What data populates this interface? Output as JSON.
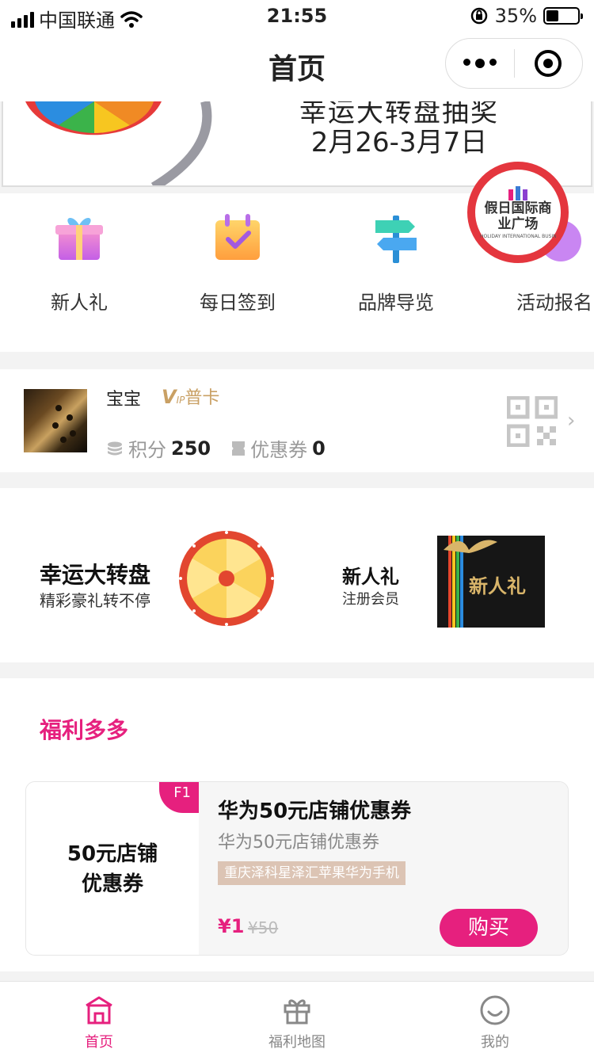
{
  "status_bar": {
    "carrier": "中国联通",
    "time": "21:55",
    "battery": "35%",
    "battery_level": 0.35
  },
  "nav": {
    "title": "首页"
  },
  "banner": {
    "title": "幸运大转盘抽奖",
    "dates": "2月26-3月7日"
  },
  "quick_entries": [
    {
      "label": "新人礼",
      "icon": "gift-icon"
    },
    {
      "label": "每日签到",
      "icon": "calendar-check-icon"
    },
    {
      "label": "品牌导览",
      "icon": "signpost-icon"
    },
    {
      "label": "活动报名",
      "icon": "activity-icon"
    }
  ],
  "logo_badge": {
    "text": "假日国际商业广场",
    "subtext": "HOLIDAY INTERNATIONAL BUSINESS PLAZA"
  },
  "member": {
    "name": "宝宝",
    "vip_mark": "V",
    "vip_level": "普卡",
    "points_label": "积分",
    "points": "250",
    "coupons_label": "优惠券",
    "coupons": "0"
  },
  "promos": {
    "wheel_title": "幸运大转盘",
    "wheel_sub": "精彩豪礼转不停",
    "gift_title": "新人礼",
    "gift_sub": "注册会员",
    "gift_box_text": "新人礼"
  },
  "welfare": {
    "section_title": "福利多多",
    "coupon": {
      "badge": "F1",
      "left_line1": "50元店铺",
      "left_line2": "优惠券",
      "title": "华为50元店铺优惠券",
      "subtitle": "华为50元店铺优惠券",
      "tag": "重庆泽科星泽汇苹果华为手机",
      "price": "¥1",
      "original_price": "¥50",
      "buy_label": "购买"
    }
  },
  "tabbar": [
    {
      "label": "首页",
      "icon": "store-icon",
      "active": true
    },
    {
      "label": "福利地图",
      "icon": "gift-box-icon",
      "active": false
    },
    {
      "label": "我的",
      "icon": "smile-icon",
      "active": false
    }
  ],
  "colors": {
    "accent": "#e6207e",
    "vip_gold": "#c9a064",
    "badge_ring": "#e4363e"
  }
}
